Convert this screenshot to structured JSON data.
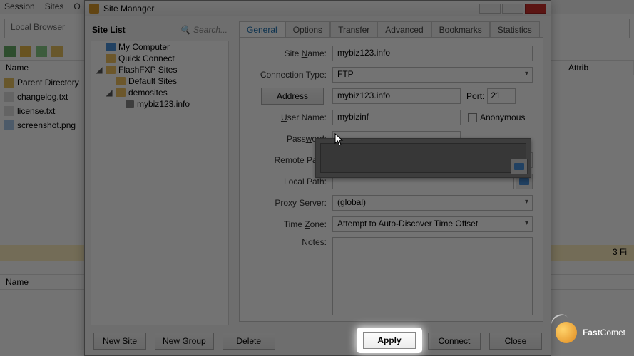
{
  "menubar": {
    "session": "Session",
    "sites": "Sites",
    "options": "O"
  },
  "local_browser_placeholder": "Local Browser",
  "columns": {
    "name": "Name",
    "attrib": "Attrib"
  },
  "filelist": {
    "parent": "Parent Directory",
    "changelog": "changelog.txt",
    "license": "license.txt",
    "screenshot": "screenshot.png"
  },
  "status_strip": "3 Fi",
  "log_header": "Name",
  "dialog": {
    "title": "Site Manager",
    "sitelist": {
      "header": "Site List",
      "search_placeholder": "Search...",
      "tree": {
        "my_computer": "My Computer",
        "quick_connect": "Quick Connect",
        "flashfxp_sites": "FlashFXP Sites",
        "default_sites": "Default Sites",
        "demosites": "demosites",
        "mybiz": "mybiz123.info"
      }
    },
    "tabs": {
      "general": "General",
      "options": "Options",
      "transfer": "Transfer",
      "advanced": "Advanced",
      "bookmarks": "Bookmarks",
      "statistics": "Statistics"
    },
    "form": {
      "site_name_label": "Site Name:",
      "site_name_value": "mybiz123.info",
      "conn_type_label": "Connection Type:",
      "conn_type_value": "FTP",
      "address_btn": "Address",
      "address_value": "mybiz123.info",
      "port_label": "Port:",
      "port_value": "21",
      "user_label": "User Name:",
      "user_value": "mybizinf",
      "anonymous_label": "Anonymous",
      "password_label": "Password:",
      "remote_path_label": "Remote Path:",
      "local_path_label": "Local Path:",
      "proxy_label": "Proxy Server:",
      "proxy_value": "(global)",
      "tz_label": "Time Zone:",
      "tz_value": "Attempt to Auto-Discover Time Offset",
      "notes_label": "Notes:"
    },
    "buttons": {
      "new_site": "New Site",
      "new_group": "New Group",
      "delete": "Delete",
      "apply": "Apply",
      "connect": "Connect",
      "close": "Close"
    }
  },
  "brand": {
    "fast": "Fast",
    "comet": "Comet"
  }
}
